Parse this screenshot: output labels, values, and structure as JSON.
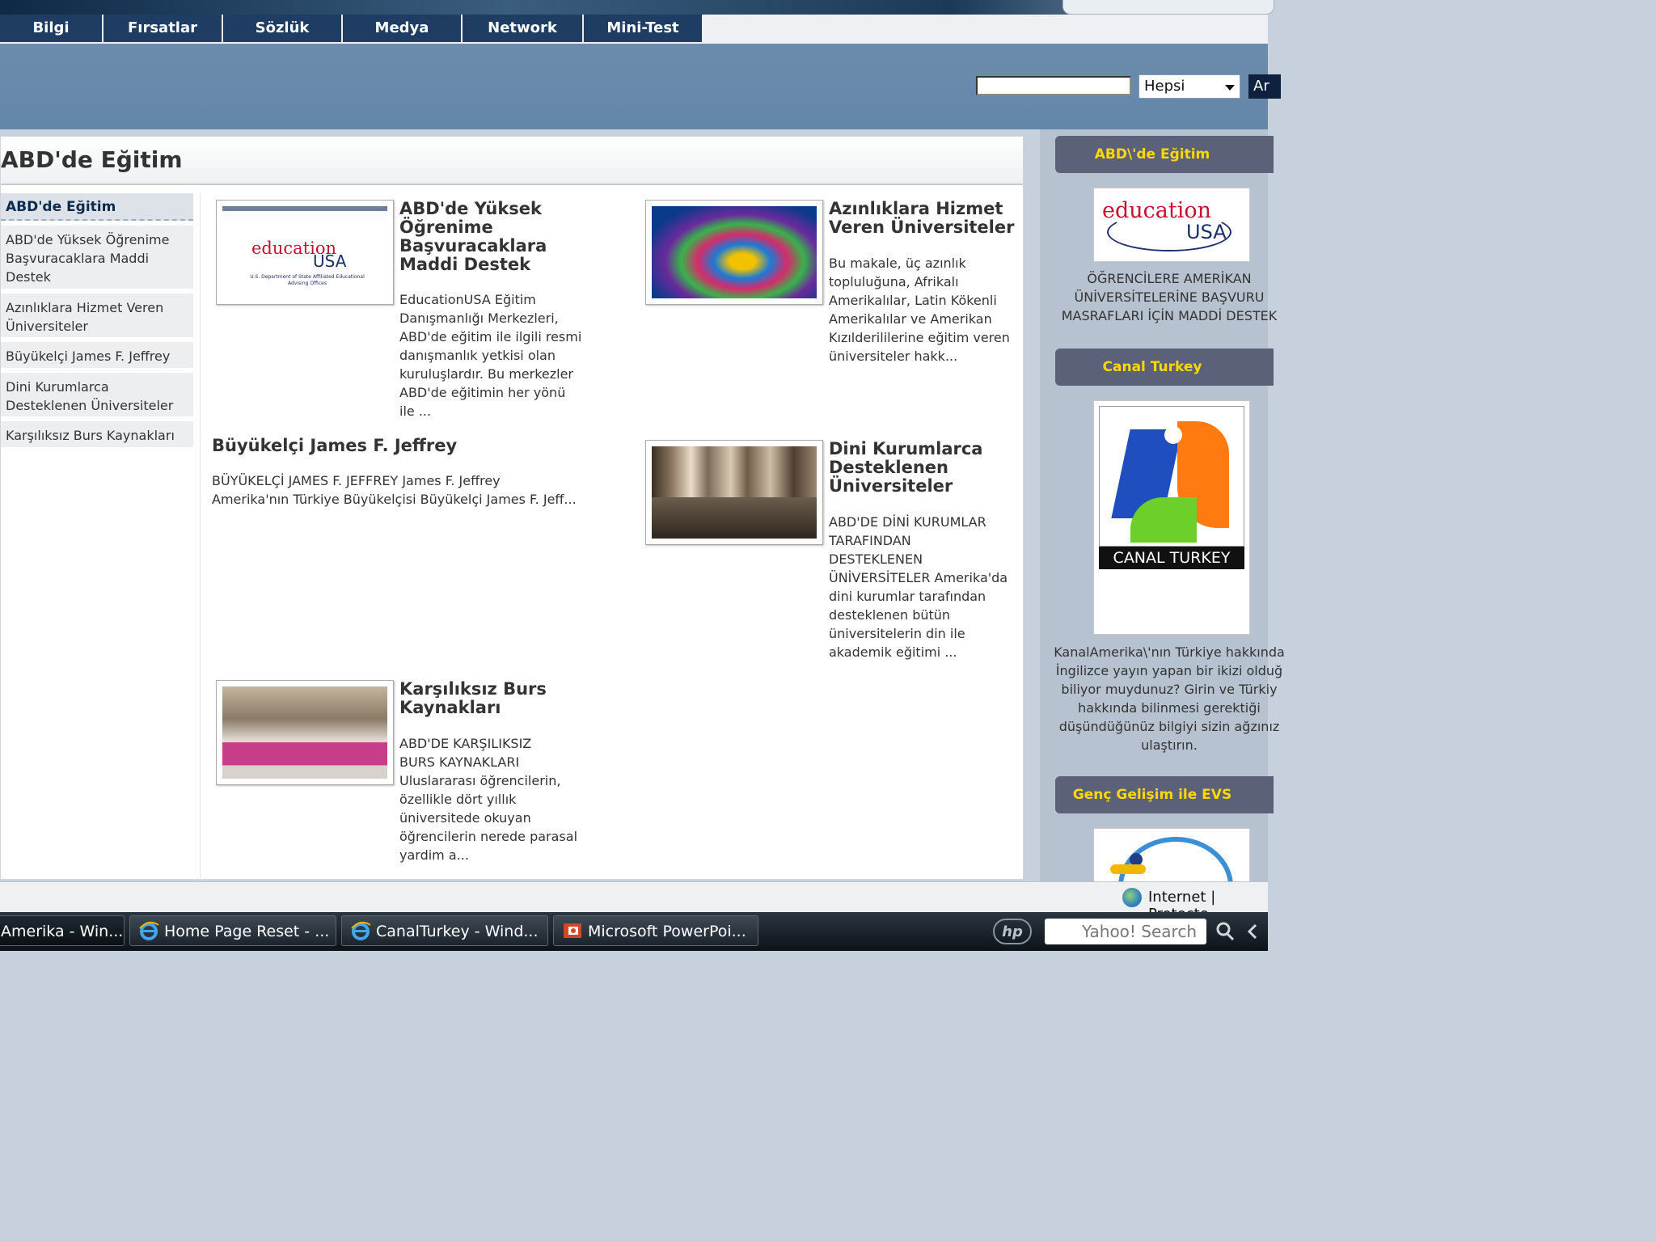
{
  "nav": {
    "tabs": [
      "Bilgi",
      "Fırsatlar",
      "Sözlük",
      "Medya",
      "Network",
      "Mini-Test"
    ]
  },
  "search": {
    "scope_value": "Hepsi",
    "button_label": "Ar"
  },
  "main": {
    "title": "ABD'de Eğitim",
    "left_nav": [
      "ABD'de Eğitim",
      "ABD'de Yüksek Öğrenime Başvuracaklara Maddi Destek",
      "Azınlıklara Hizmet Veren Üniversiteler",
      "Büyükelçi James F. Jeffrey",
      "Dini Kurumlarca Desteklenen Üniversiteler",
      "Karşılıksız Burs Kaynakları"
    ],
    "articles": {
      "maddi": {
        "title": "ABD'de Yüksek Öğrenime Başvuracaklara Maddi Destek",
        "text": "EducationUSA Eğitim\nDanışmanlığı Merkezleri,\nABD'de eğitim ile ilgili resmi\ndanışmanlık yetkisi olan\nkuruluşlardır. Bu merkezler\nABD'de eğitimin her yönü\nile ...",
        "logo_word1": "education",
        "logo_word2": "USA",
        "logo_small": "U.S. Department of State Affiliated Educational Advising Offices"
      },
      "azinlik": {
        "title": "Azınlıklara Hizmet Veren Üniversiteler",
        "text": "  Bu makale, üç azınlık\ntopluluğuna, Afrikalı\nAmerikalılar, Latin Kökenli\nAmerikalılar ve Amerikan\nKızılderililerine eğitim veren\nüniversiteler hakk..."
      },
      "jeffrey": {
        "title": "Büyükelçi James F. Jeffrey",
        "text": "  BÜYÜKELÇİ JAMES F. JEFFREY   James F. Jeffrey\nAmerika'nın Türkiye Büyükelçisi Büyükelçi James F. Jeff..."
      },
      "dini": {
        "title": "Dini Kurumlarca Desteklenen Üniversiteler",
        "text": "ABD'DE DİNİ KURUMLAR\nTARAFINDAN\nDESTEKLENEN\nÜNİVERSİTELER Amerika'da\ndini kurumlar tarafından\ndesteklenen bütün\nüniversitelerin din ile\nakademik eğitimi ..."
      },
      "burs": {
        "title": "Karşılıksız Burs Kaynakları",
        "text": "  ABD'DE KARŞILIKSIZ\nBURS KAYNAKLARI\nUluslararası öğrencilerin,\nözellikle dört yıllık\nüniversitede okuyan\nöğrencilerin nerede parasal\nyardim a..."
      }
    }
  },
  "right": {
    "box1": {
      "header": "ABD\\'de Eğitim",
      "logo_word1": "education",
      "logo_word2": "USA",
      "text": "ÖĞRENCİLERE AMERİKAN\nÜNİVERSİTELERİNE BAŞVURU\nMASRAFLARI İÇİN MADDİ DESTEK"
    },
    "box2": {
      "header": "Canal Turkey",
      "logo_caption": "CANAL TURKEY",
      "text": "KanalAmerika\\'nın Türkiye hakkında\nİngilizce yayın yapan bir ikizi olduğ\nbiliyor muydunuz? Girin ve Türkiy\nhakkında bilinmesi gerektiği\ndüşündüğünüz bilgiyi sizin ağzınız\nulaştırın."
    },
    "box3": {
      "header": "Genç Gelişim ile EVS"
    }
  },
  "statusbar": {
    "zone": "Internet | Protecte"
  },
  "taskbar": {
    "buttons": [
      "Amerika - Win...",
      "Home Page Reset - ...",
      "CanalTurkey - Wind...",
      "Microsoft PowerPoi..."
    ],
    "search_placeholder": "Yahoo! Search",
    "hp_logo": "hp"
  },
  "colors": {
    "nav_tab": "#1f3d63",
    "blue_band": "#6386a9",
    "right_header": "#5b6178",
    "right_header_text": "#ffd800",
    "education_red": "#c8102e",
    "education_navy": "#1b2f6b"
  },
  "icons": {
    "ie": "ie-icon",
    "powerpoint": "powerpoint-icon",
    "globe": "internet-zone-icon",
    "search": "magnifier-icon"
  }
}
